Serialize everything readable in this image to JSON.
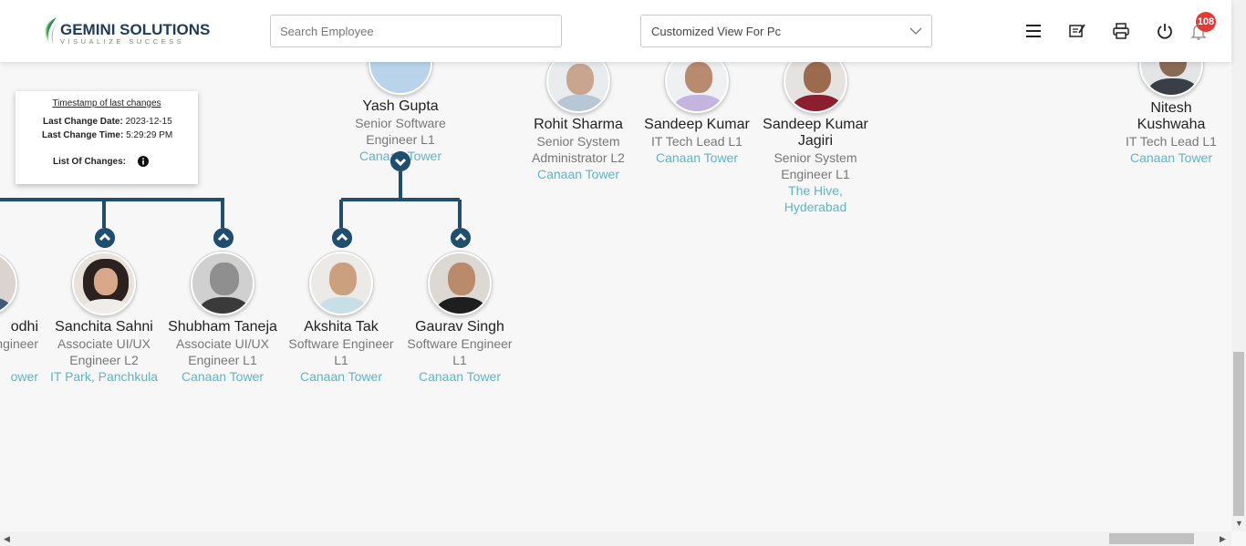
{
  "app": {
    "logo_name": "GEMINI SOLUTIONS",
    "logo_tagline": "VISUALIZE SUCCESS",
    "search_placeholder": "Search Employee",
    "view_selected": "Customized View For Pc",
    "notification_count": "108",
    "accent_color": "#1f4e6e",
    "location_color": "#5db5c8"
  },
  "timestamp_panel": {
    "title": "Timestamp of last changes",
    "date_label": "Last Change Date:",
    "date_value": "2023-12-15",
    "time_label": "Last Change Time:",
    "time_value": "5:29:29 PM",
    "changes_label": "List Of Changes:"
  },
  "top_nodes": [
    {
      "name": "Yash Gupta",
      "designation_1": "Senior Software",
      "designation_2": "Engineer L1",
      "location": "Canaan Tower"
    },
    {
      "name": "Rohit Sharma",
      "designation_1": "Senior System",
      "designation_2": "Administrator L2",
      "location": "Canaan Tower"
    },
    {
      "name": "Sandeep Kumar",
      "designation_1": "IT Tech Lead L1",
      "location": "Canaan Tower"
    },
    {
      "name_1": "Sandeep Kumar",
      "name_2": "Jagiri",
      "designation_1": "Senior System",
      "designation_2": "Engineer L1",
      "location_1": "The Hive,",
      "location_2": "Hyderabad"
    },
    {
      "name_1": "Nitesh",
      "name_2": "Kushwaha",
      "designation_1": "IT Tech Lead L1",
      "location": "Canaan Tower"
    }
  ],
  "bottom_nodes": [
    {
      "name": "odhi",
      "designation_1": "ngineer",
      "location": "ower"
    },
    {
      "name": "Sanchita Sahni",
      "designation_1": "Associate UI/UX",
      "designation_2": "Engineer L2",
      "location": "IT Park, Panchkula"
    },
    {
      "name": "Shubham Taneja",
      "designation_1": "Associate UI/UX",
      "designation_2": "Engineer L1",
      "location": "Canaan Tower"
    },
    {
      "name": "Akshita Tak",
      "designation_1": "Software Engineer",
      "designation_2": "L1",
      "location": "Canaan Tower"
    },
    {
      "name": "Gaurav Singh",
      "designation_1": "Software Engineer",
      "designation_2": "L1",
      "location": "Canaan Tower"
    }
  ]
}
